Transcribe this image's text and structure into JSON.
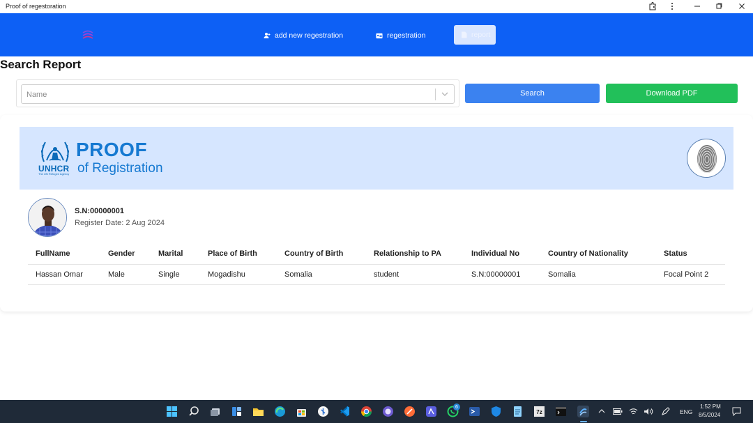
{
  "window": {
    "title": "Proof of regestoration"
  },
  "nav": {
    "items": [
      {
        "label": "add new regestration"
      },
      {
        "label": "regestration"
      },
      {
        "label": "report"
      }
    ]
  },
  "page": {
    "title": "Search Report"
  },
  "search": {
    "placeholder": "Name",
    "search_label": "Search",
    "download_label": "Download PDF"
  },
  "report": {
    "logo": {
      "org": "UNHCR",
      "org_sub": "The UN Refugee Agency",
      "title_main": "PROOF",
      "title_sub": "of Registration"
    },
    "serial": "S.N:00000001",
    "register_date": "Register Date: 2 Aug 2024",
    "columns": [
      "FullName",
      "Gender",
      "Marital",
      "Place of Birth",
      "Country of Birth",
      "Relationship to PA",
      "Individual No",
      "Country of Nationality",
      "Status"
    ],
    "rows": [
      [
        "Hassan Omar",
        "Male",
        "Single",
        "Mogadishu",
        "Somalia",
        "student",
        "S.N:00000001",
        "Somalia",
        "Focal Point 2"
      ]
    ]
  },
  "taskbar": {
    "language": "ENG",
    "time": "1:52 PM",
    "date": "8/5/2024",
    "whatsapp_badge": "6"
  },
  "colors": {
    "nav_bg": "#0d60f5",
    "search_btn": "#3b82f0",
    "pdf_btn": "#22c05a",
    "banner_bg": "#d6e6ff",
    "brand_blue": "#1679d1"
  }
}
